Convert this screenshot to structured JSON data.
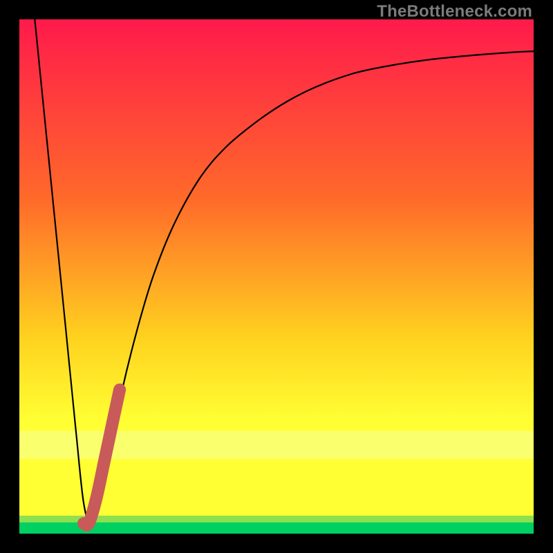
{
  "watermark": "TheBottleneck.com",
  "colors": {
    "gradient_top": "#ff1a4b",
    "gradient_mid1": "#ff6a2a",
    "gradient_mid2": "#ffd21f",
    "gradient_yellow": "#ffff33",
    "band_pale": "#f6ff9f",
    "band_green1": "#8fe04e",
    "band_green2": "#00d062",
    "curve": "#000000",
    "highlight": "#c85a5a",
    "frame": "#000000"
  },
  "chart_data": {
    "type": "line",
    "title": "",
    "xlabel": "",
    "ylabel": "",
    "xlim": [
      0,
      100
    ],
    "ylim": [
      0,
      100
    ],
    "series": [
      {
        "name": "bottleneck-curve",
        "x": [
          3,
          5,
          7,
          9,
          11,
          12.5,
          14,
          16,
          18,
          20,
          23,
          26,
          30,
          35,
          40,
          46,
          52,
          58,
          65,
          72,
          80,
          88,
          96,
          100
        ],
        "y": [
          100,
          80,
          60,
          40,
          20,
          6,
          2,
          8,
          18,
          28,
          40,
          50,
          60,
          69,
          75,
          80,
          84,
          87,
          89.5,
          91,
          92.2,
          93,
          93.6,
          93.8
        ]
      },
      {
        "name": "highlight-segment",
        "x": [
          12.5,
          13.5,
          15,
          16.5,
          18,
          19.5
        ],
        "y": [
          2,
          2,
          7,
          14,
          21,
          28
        ]
      }
    ],
    "annotations": []
  }
}
